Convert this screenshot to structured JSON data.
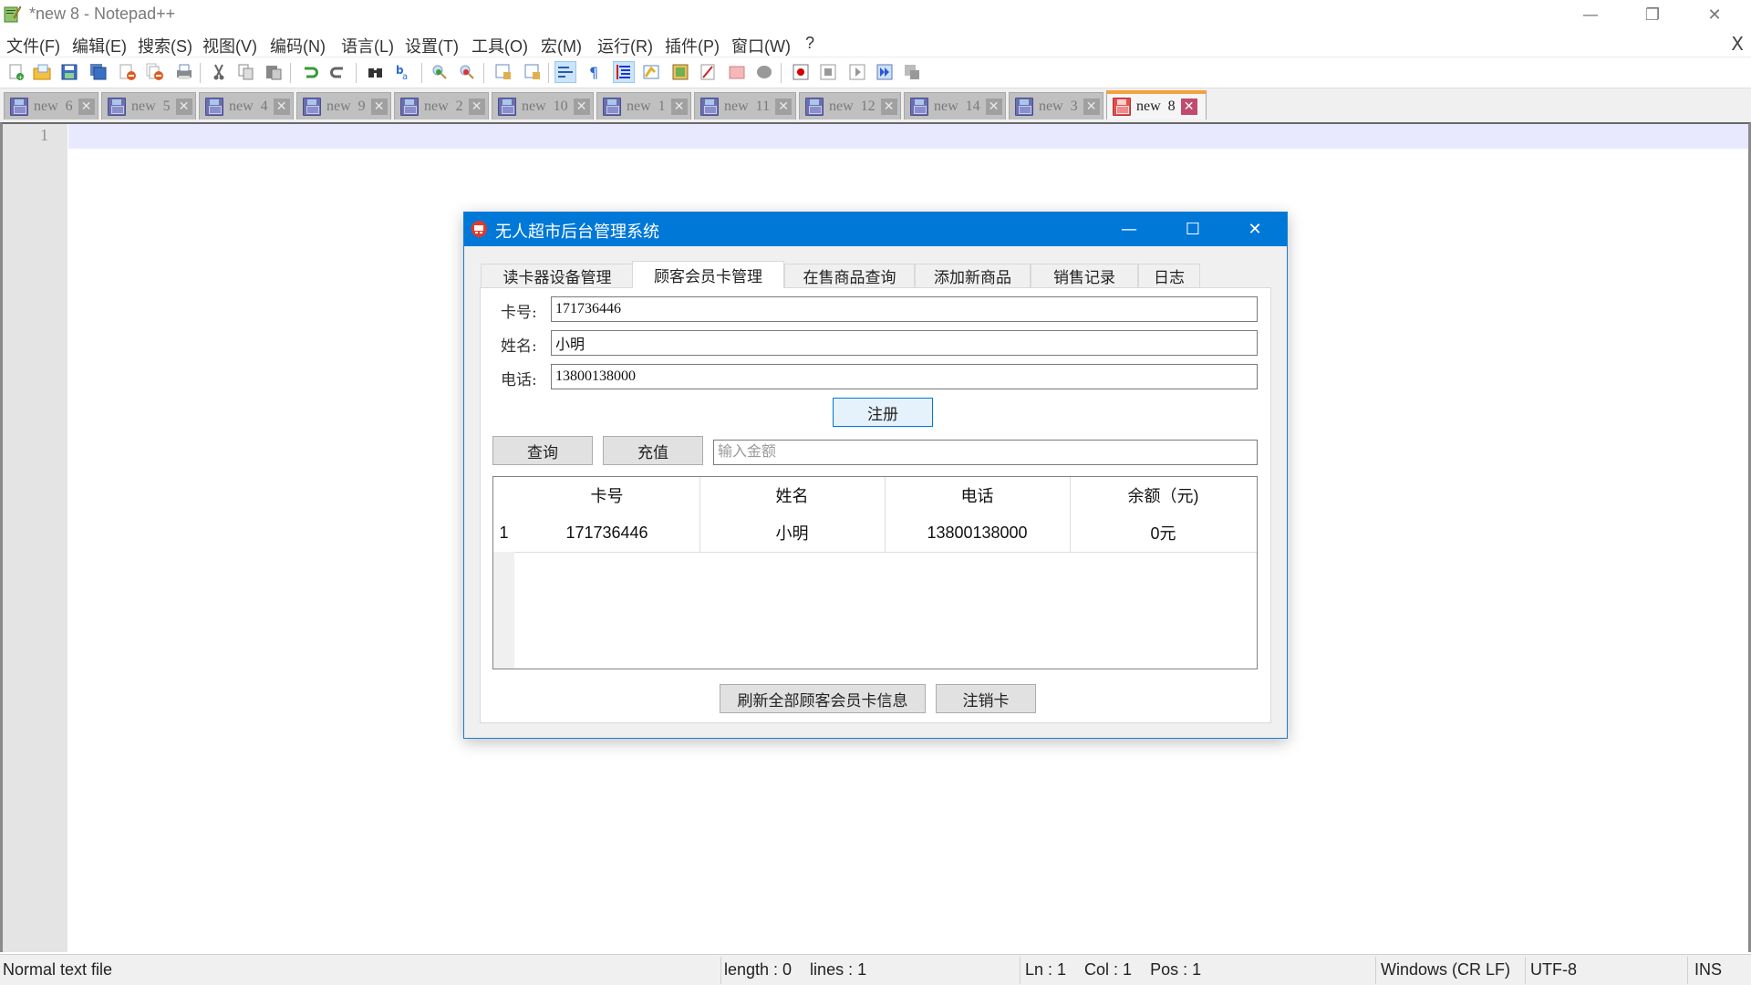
{
  "window": {
    "title": "*new 8 - Notepad++",
    "controls": {
      "minimize": "—",
      "restore": "❐",
      "close": "✕"
    }
  },
  "menu": {
    "items": [
      "文件(F)",
      "编辑(E)",
      "搜索(S)",
      "视图(V)",
      "编码(N)",
      "语言(L)",
      "设置(T)",
      "工具(O)",
      "宏(M)",
      "运行(R)",
      "插件(P)",
      "窗口(W)",
      "?"
    ],
    "close_doc": "X"
  },
  "toolbar": {
    "buttons": [
      "new-file",
      "open-file",
      "save",
      "save-all",
      "close",
      "close-all",
      "print",
      "cut",
      "copy",
      "paste",
      "undo",
      "redo",
      "find",
      "replace",
      "zoom-in",
      "zoom-out",
      "sync-vertical",
      "sync-horizontal",
      "word-wrap",
      "show-all-chars",
      "indent-guide",
      "user-defined-lang",
      "document-map",
      "function-list",
      "folder-as-workspace",
      "monitoring",
      "record-macro",
      "stop-recording",
      "play-macro",
      "run-macro-multiple",
      "save-macro"
    ]
  },
  "doc_tabs": [
    {
      "label": "new  6",
      "active": false
    },
    {
      "label": "new  5",
      "active": false
    },
    {
      "label": "new  4",
      "active": false
    },
    {
      "label": "new  9",
      "active": false
    },
    {
      "label": "new  2",
      "active": false
    },
    {
      "label": "new  10",
      "active": false
    },
    {
      "label": "new  1",
      "active": false
    },
    {
      "label": "new  11",
      "active": false
    },
    {
      "label": "new  12",
      "active": false
    },
    {
      "label": "new  14",
      "active": false
    },
    {
      "label": "new  3",
      "active": false
    },
    {
      "label": "new  8",
      "active": true
    }
  ],
  "editor": {
    "line_numbers": [
      "1"
    ],
    "content": ""
  },
  "statusbar": {
    "file_type": "Normal text file",
    "length_lines": "length : 0    lines : 1",
    "position": "Ln : 1    Col : 1    Pos : 1",
    "eol": "Windows (CR LF)",
    "encoding": "UTF-8",
    "mode": "INS"
  },
  "dialog": {
    "title": "无人超市后台管理系统",
    "controls": {
      "minimize": "—",
      "maximize": "☐",
      "close": "✕"
    },
    "tabs": [
      {
        "label": "读卡器设备管理",
        "active": false
      },
      {
        "label": "顾客会员卡管理",
        "active": true
      },
      {
        "label": "在售商品查询",
        "active": false
      },
      {
        "label": "添加新商品",
        "active": false
      },
      {
        "label": "销售记录",
        "active": false
      },
      {
        "label": "日志",
        "active": false
      }
    ],
    "form": {
      "card_label": "卡号:",
      "card_value": "171736446",
      "name_label": "姓名:",
      "name_value": "小明",
      "phone_label": "电话:",
      "phone_value": "13800138000",
      "register_button": "注册",
      "query_button": "查询",
      "recharge_button": "充值",
      "amount_placeholder": "输入金额",
      "amount_value": ""
    },
    "table": {
      "columns": [
        "卡号",
        "姓名",
        "电话",
        "余额（元)"
      ],
      "rows": [
        {
          "row_no": "1",
          "cells": [
            "171736446",
            "小明",
            "13800138000",
            "0元"
          ]
        }
      ]
    },
    "refresh_button": "刷新全部顾客会员卡信息",
    "cancel_card_button": "注销卡"
  }
}
